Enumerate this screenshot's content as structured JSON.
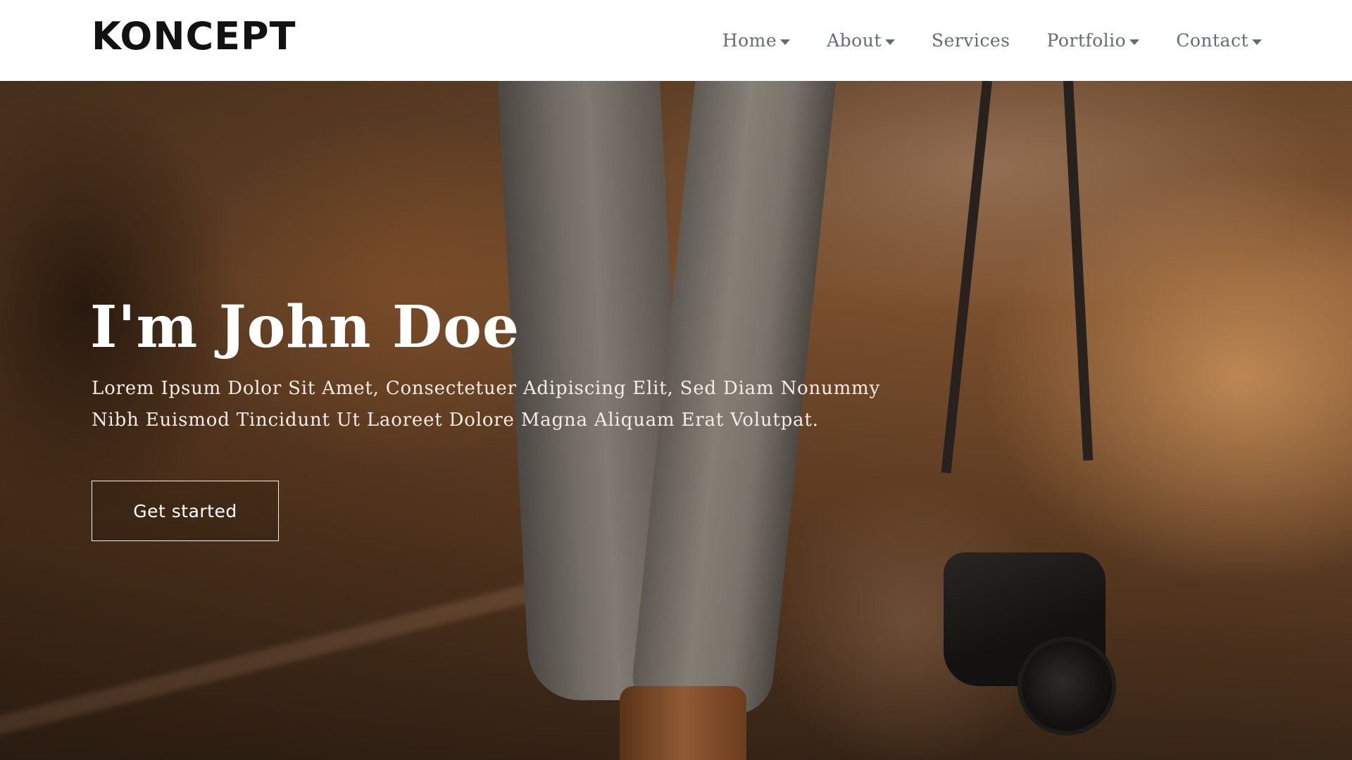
{
  "brand": {
    "logo_text": "KONCEPT"
  },
  "nav": {
    "items": [
      {
        "label": "Home",
        "has_dropdown": true
      },
      {
        "label": "About",
        "has_dropdown": true
      },
      {
        "label": "Services",
        "has_dropdown": false
      },
      {
        "label": "Portfolio",
        "has_dropdown": true
      },
      {
        "label": "Contact",
        "has_dropdown": true
      }
    ]
  },
  "hero": {
    "title": "I'm John Doe",
    "description": "Lorem Ipsum Dolor Sit Amet, Consectetuer Adipiscing Elit, Sed Diam Nonummy Nibh Euismod Tincidunt Ut Laoreet Dolore Magna Aliquam Erat Volutpat.",
    "cta_label": "Get started",
    "background_image": "person-walking-with-camera-photo"
  },
  "colors": {
    "nav_text": "#666c6c",
    "logo": "#111111",
    "hero_text": "#ffffff"
  }
}
